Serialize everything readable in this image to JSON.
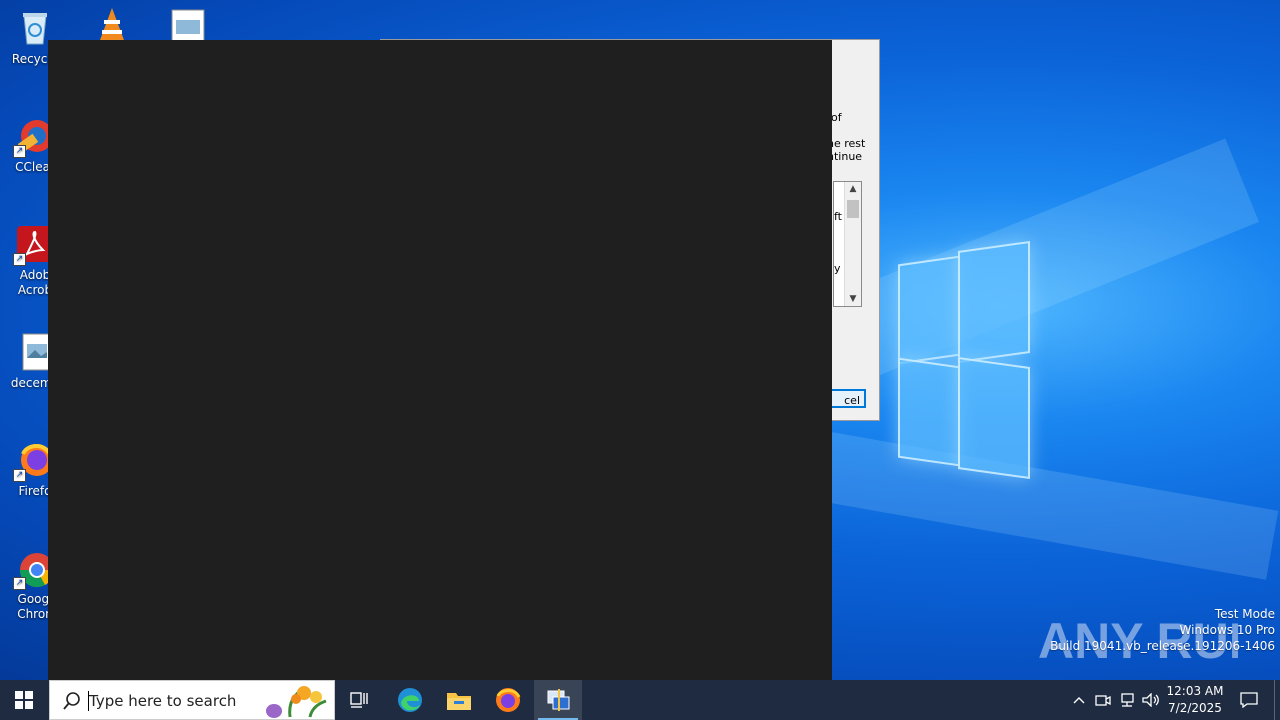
{
  "desktop": {
    "icons": [
      {
        "label": "Recycle",
        "icon": "recycle-bin-icon"
      },
      {
        "label": "CClear",
        "icon": "ccleaner-icon"
      },
      {
        "label": "Adob\nAcrob",
        "icon": "adobe-acrobat-icon"
      },
      {
        "label": "decemb",
        "icon": "image-file-icon"
      },
      {
        "label": "Firefo",
        "icon": "firefox-icon"
      },
      {
        "label": "Googl\nChron",
        "icon": "chrome-icon"
      }
    ],
    "top_icons": [
      "vlc-icon",
      "image-file-icon"
    ]
  },
  "dialog": {
    "fragments": {
      "line1": "of",
      "line2": "he rest",
      "line3": "ntinue",
      "list1": "ft",
      "list2": "y"
    },
    "cancel_label": "cel"
  },
  "watermark": {
    "brand": "ANY RUN",
    "line1": "Test Mode",
    "line2": "Windows 10 Pro",
    "line3": "Build 19041.vb_release.191206-1406"
  },
  "taskbar": {
    "search_placeholder": "Type here to search",
    "apps": [
      "task-view-icon",
      "edge-icon",
      "file-explorer-icon",
      "firefox-icon",
      "active-app-icon"
    ],
    "clock_time": "12:03 AM",
    "clock_date": "7/2/2025"
  },
  "colors": {
    "desktop_blue": "#0b63d8",
    "taskbar": "#1e2b40",
    "dark_window": "#1f1f1f",
    "accent": "#0078d7"
  }
}
